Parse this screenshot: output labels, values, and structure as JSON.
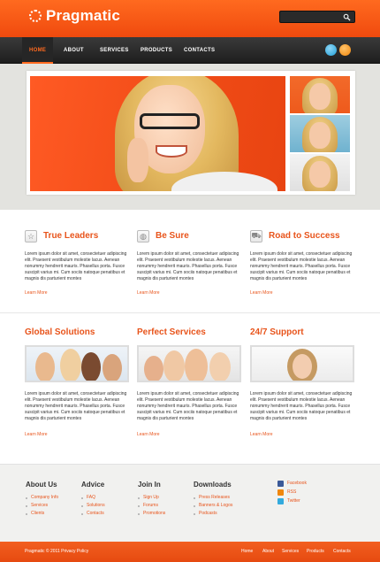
{
  "header": {
    "logo_text": "Pragmatic",
    "search_placeholder": ""
  },
  "nav": {
    "items": [
      "HOME",
      "ABOUT",
      "SERVICES",
      "PRODUCTS",
      "CONTACTS"
    ]
  },
  "features_row1": [
    {
      "title": "True Leaders",
      "icon": "star-icon",
      "text": "Lorem ipsum dolor sit amet, consectetuer adipiscing elit. Praesent vestibulum molestie lacus. Aenean nonummy hendrerit mauris. Phasellus porta. Fusce suscipit varius mi. Cum sociis natoque penatibus et magnis dis parturient montes",
      "link": "Learn More"
    },
    {
      "title": "Be Sure",
      "icon": "globe-icon",
      "text": "Lorem ipsum dolor sit amet, consectetuer adipiscing elit. Praesent vestibulum molestie lacus. Aenean nonummy hendrerit mauris. Phasellus porta. Fusce suscipit varius mi. Cum sociis natoque penatibus et magnis dis parturient montes",
      "link": "Learn More"
    },
    {
      "title": "Road to Success",
      "icon": "truck-icon",
      "text": "Lorem ipsum dolor sit amet, consectetuer adipiscing elit. Praesent vestibulum molestie lacus. Aenean nonummy hendrerit mauris. Phasellus porta. Fusce suscipit varius mi. Cum sociis natoque penatibus et magnis dis parturient montes",
      "link": "Learn More"
    }
  ],
  "features_row2": [
    {
      "title": "Global Solutions",
      "text": "Lorem ipsum dolor sit amet, consectetuer adipiscing elit. Praesent vestibulum molestie lacus. Aenean nonummy hendrerit mauris. Phasellus porta. Fusce suscipit varius mi. Cum sociis natoque penatibus et magnis dis parturient montes",
      "link": "Learn More"
    },
    {
      "title": "Perfect Services",
      "text": "Lorem ipsum dolor sit amet, consectetuer adipiscing elit. Praesent vestibulum molestie lacus. Aenean nonummy hendrerit mauris. Phasellus porta. Fusce suscipit varius mi. Cum sociis natoque penatibus et magnis dis parturient montes",
      "link": "Learn More"
    },
    {
      "title": "24/7 Support",
      "text": "Lorem ipsum dolor sit amet, consectetuer adipiscing elit. Praesent vestibulum molestie lacus. Aenean nonummy hendrerit mauris. Phasellus porta. Fusce suscipit varius mi. Cum sociis natoque penatibus et magnis dis parturient montes",
      "link": "Learn More"
    }
  ],
  "footer": {
    "about": {
      "title": "About Us",
      "links": [
        "Company Info",
        "Services",
        "Clients"
      ]
    },
    "advice": {
      "title": "Advice",
      "links": [
        "FAQ",
        "Solutions",
        "Contacts"
      ]
    },
    "join": {
      "title": "Join In",
      "links": [
        "Sign Up",
        "Forums",
        "Promotions"
      ]
    },
    "downloads": {
      "title": "Downloads",
      "links": [
        "Press Releases",
        "Banners & Logos",
        "Podcasts"
      ]
    },
    "social": [
      {
        "label": "Facebook",
        "color": "#3b5998"
      },
      {
        "label": "RSS",
        "color": "#f0860c"
      },
      {
        "label": "Twitter",
        "color": "#33aadd"
      }
    ]
  },
  "bottom": {
    "copyright": "Pragmatic © 2011 Privacy Policy",
    "nav": [
      "Home",
      "About",
      "Services",
      "Products",
      "Contacts"
    ]
  },
  "colors": {
    "accent": "#e8541b",
    "nav_bg": "#2b2b2b"
  }
}
